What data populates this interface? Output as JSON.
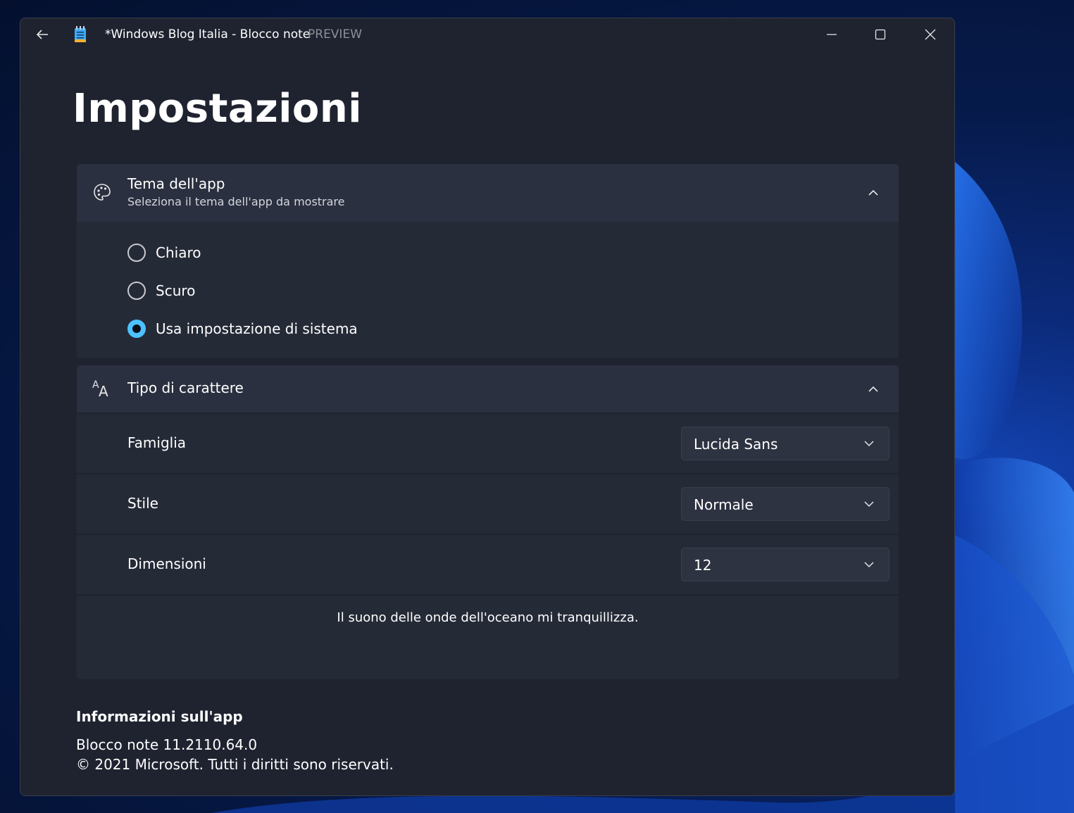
{
  "window": {
    "title": "*Windows Blog Italia - Blocco note",
    "title_suffix": "PREVIEW"
  },
  "page": {
    "title": "Impostazioni"
  },
  "theme_card": {
    "title": "Tema dell'app",
    "subtitle": "Seleziona il tema dell'app da mostrare",
    "expanded": true,
    "options": [
      {
        "label": "Chiaro",
        "checked": false
      },
      {
        "label": "Scuro",
        "checked": false
      },
      {
        "label": "Usa impostazione di sistema",
        "checked": true
      }
    ]
  },
  "font_card": {
    "title": "Tipo di carattere",
    "expanded": true,
    "settings": [
      {
        "label": "Famiglia",
        "value": "Lucida Sans"
      },
      {
        "label": "Stile",
        "value": "Normale"
      },
      {
        "label": "Dimensioni",
        "value": "12"
      }
    ],
    "preview_text": "Il suono delle onde dell'oceano mi tranquillizza."
  },
  "about": {
    "heading": "Informazioni sull'app",
    "version": "Blocco note 11.2110.64.0",
    "copyright": "© 2021 Microsoft. Tutti i diritti sono riservati."
  },
  "colors": {
    "accent": "#4cc2ff",
    "window_bg": "#1f2330",
    "card_bg": "#252a37"
  },
  "icons": {
    "back": "back-arrow-icon",
    "app": "notepad-icon",
    "minimize": "minimize-icon",
    "maximize": "maximize-icon",
    "close": "close-icon",
    "theme": "palette-icon",
    "font": "font-icon",
    "collapse": "chevron-up-icon",
    "dropdown": "chevron-down-icon"
  }
}
